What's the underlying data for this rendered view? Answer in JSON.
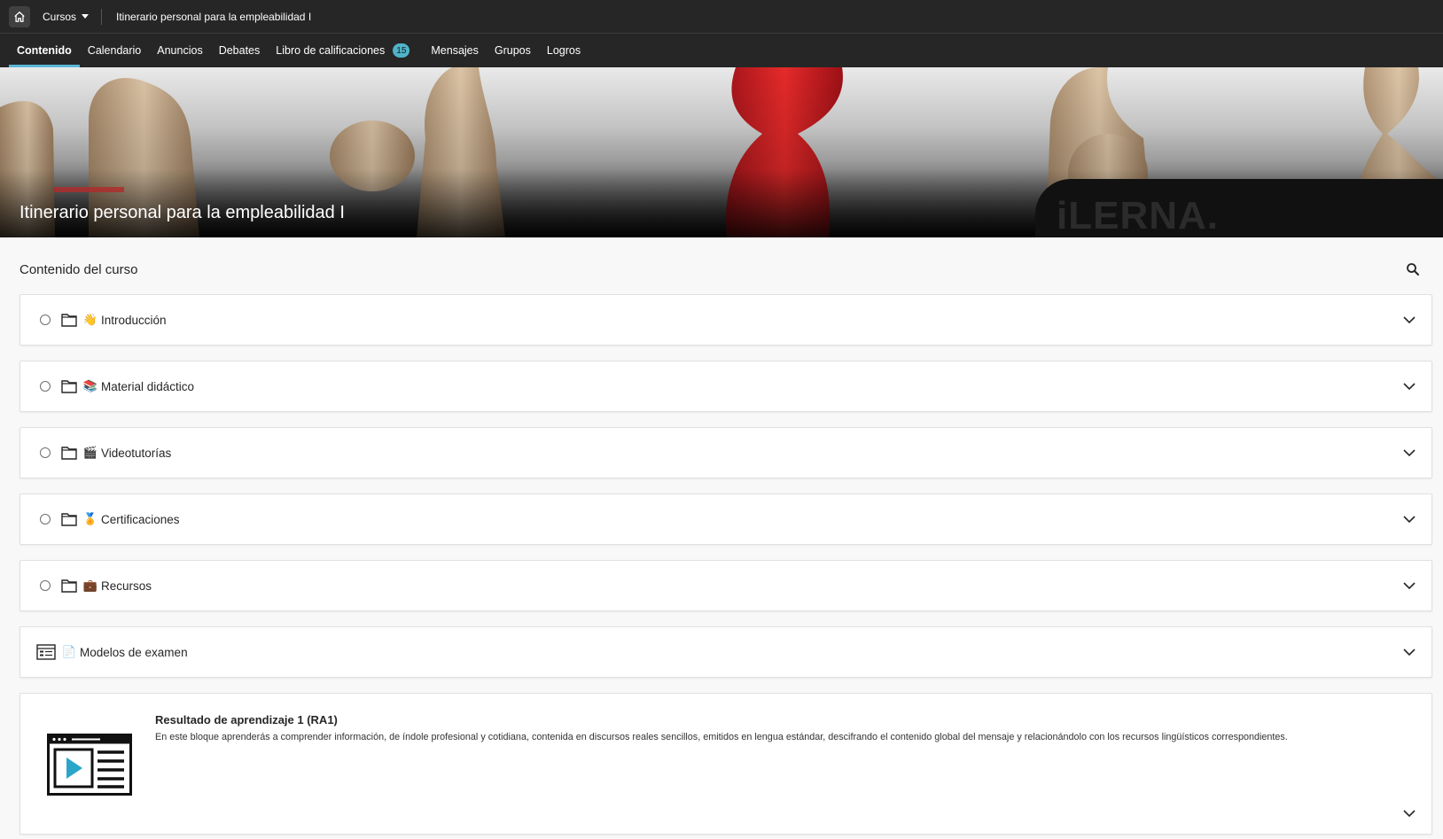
{
  "topbar": {
    "courses_label": "Cursos",
    "course_name": "Itinerario personal para la empleabilidad I"
  },
  "nav": {
    "tabs": [
      {
        "label": "Contenido",
        "active": true
      },
      {
        "label": "Calendario"
      },
      {
        "label": "Anuncios"
      },
      {
        "label": "Debates"
      },
      {
        "label": "Libro de calificaciones",
        "badge": "15"
      },
      {
        "label": "Mensajes"
      },
      {
        "label": "Grupos"
      },
      {
        "label": "Logros"
      }
    ]
  },
  "banner": {
    "title": "Itinerario personal para la empleabilidad I",
    "brand": "iLERNA."
  },
  "content": {
    "title": "Contenido del curso",
    "items": [
      {
        "emoji": "👋",
        "title": "Introducción"
      },
      {
        "emoji": "📚",
        "title": "Material didáctico"
      },
      {
        "emoji": "🎬",
        "title": "Videotutorías"
      },
      {
        "emoji": "🏅",
        "title": "Certificaciones"
      },
      {
        "emoji": "💼",
        "title": "Recursos"
      }
    ],
    "exam": {
      "emoji": "📄",
      "title": "Modelos de examen"
    },
    "ra": {
      "title": "Resultado de aprendizaje 1 (RA1)",
      "description": "En este bloque aprenderás a comprender información, de índole profesional y cotidiana, contenida en discursos reales sencillos, emitidos en lengua estándar, descifrando el contenido global del mensaje y relacionándolo con los recursos lingüísticos correspondientes."
    }
  },
  "colors": {
    "header_bg": "#262626",
    "active_tab_underline": "#5ab6d6",
    "badge_bg": "#4fb3c8",
    "play_icon": "#2aa6c9"
  }
}
